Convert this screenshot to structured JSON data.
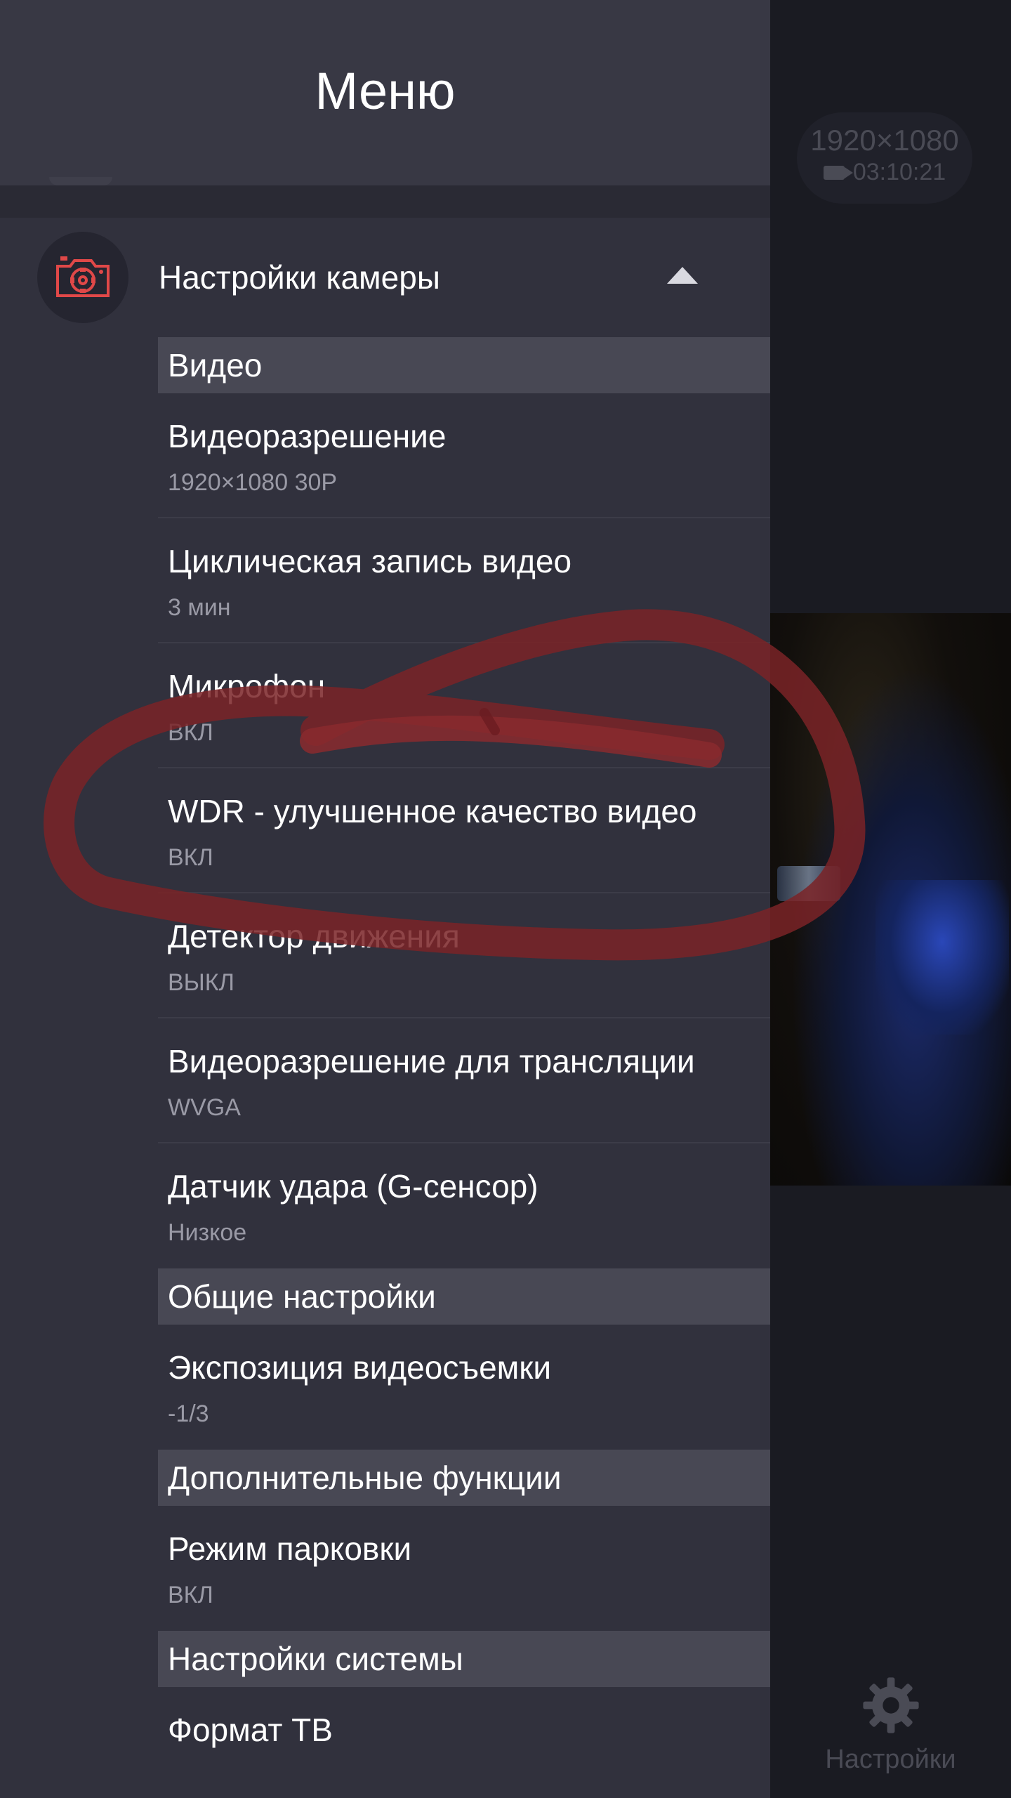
{
  "background": {
    "resolution": "1920×1080",
    "recording_time": "03:10:21",
    "settings_tab_label": "Настройки"
  },
  "drawer": {
    "title": "Меню",
    "group": {
      "label": "Настройки камеры",
      "icon": "camera-settings-icon",
      "expanded": true
    },
    "sections": [
      {
        "title": "Видео",
        "items": [
          {
            "label": "Видеоразрешение",
            "value": "1920×1080 30P"
          },
          {
            "label": "Циклическая запись видео",
            "value": "3 мин"
          },
          {
            "label": "Микрофон",
            "value": "ВКЛ"
          },
          {
            "label": "WDR - улучшенное качество видео",
            "value": "ВКЛ"
          },
          {
            "label": "Детектор движения",
            "value": "ВЫКЛ"
          },
          {
            "label": "Видеоразрешение для трансляции",
            "value": "WVGA"
          },
          {
            "label": "Датчик удара (G-сенсор)",
            "value": "Низкое"
          }
        ]
      },
      {
        "title": "Общие настройки",
        "items": [
          {
            "label": "Экспозиция видеосъемки",
            "value": "-1/3"
          }
        ]
      },
      {
        "title": "Дополнительные функции",
        "items": [
          {
            "label": "Режим парковки",
            "value": "ВКЛ"
          }
        ]
      },
      {
        "title": "Настройки системы",
        "items": [
          {
            "label": "Формат ТВ"
          }
        ]
      }
    ]
  },
  "colors": {
    "drawer_bg": "#31313d",
    "header_bg": "#383844",
    "section_bg": "#484854",
    "accent_red": "#e04848",
    "scribble": "#8a2a2e"
  }
}
